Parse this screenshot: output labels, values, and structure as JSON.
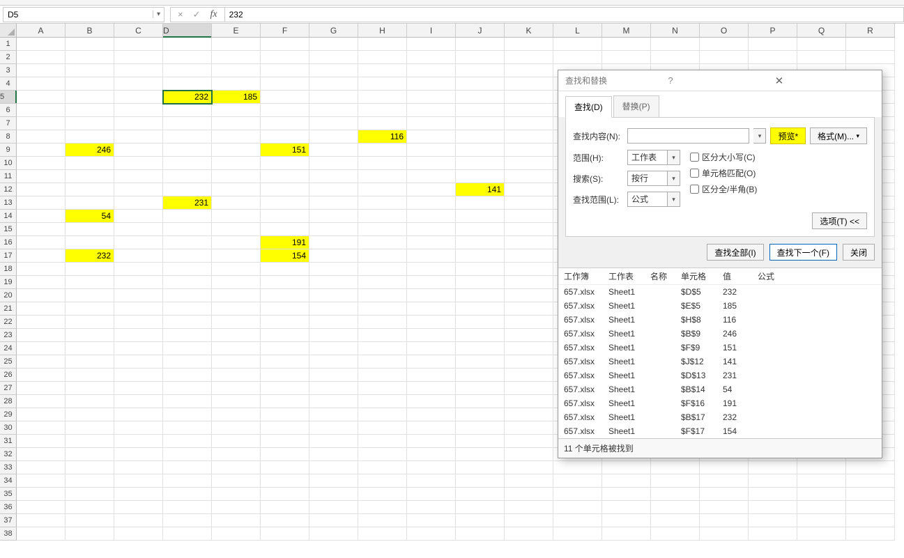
{
  "name_box": {
    "value": "D5"
  },
  "formula_bar": {
    "cancel": "×",
    "confirm": "✓",
    "fx": "fx",
    "value": "232"
  },
  "columns": [
    "A",
    "B",
    "C",
    "D",
    "E",
    "F",
    "G",
    "H",
    "I",
    "J",
    "K",
    "L",
    "M",
    "N",
    "O",
    "P",
    "Q",
    "R"
  ],
  "row_count": 38,
  "selected_col": "D",
  "selected_row": 5,
  "cells": {
    "D5": "232",
    "E5": "185",
    "H8": "116",
    "B9": "246",
    "F9": "151",
    "J12": "141",
    "D13": "231",
    "B14": "54",
    "F16": "191",
    "B17": "232",
    "F17": "154"
  },
  "highlighted": [
    "D5",
    "E5",
    "H8",
    "B9",
    "F9",
    "J12",
    "D13",
    "B14",
    "F16",
    "B17",
    "F17"
  ],
  "dialog": {
    "title": "查找和替换",
    "tabs": {
      "find": "查找(D)",
      "replace": "替换(P)"
    },
    "find_label": "查找内容(N):",
    "find_value": "",
    "preview_btn": "预览*",
    "format_btn": "格式(M)...",
    "range_label": "范围(H):",
    "range_value": "工作表",
    "search_label": "搜索(S):",
    "search_value": "按行",
    "lookin_label": "查找范围(L):",
    "lookin_value": "公式",
    "chk_case": "区分大小写(C)",
    "chk_whole": "单元格匹配(O)",
    "chk_width": "区分全/半角(B)",
    "options_btn": "选项(T) <<",
    "find_all_btn": "查找全部(I)",
    "find_next_btn": "查找下一个(F)",
    "close_btn": "关闭",
    "result_headers": {
      "workbook": "工作簿",
      "worksheet": "工作表",
      "name": "名称",
      "cell": "单元格",
      "value": "值",
      "formula": "公式"
    },
    "results": [
      {
        "wb": "657.xlsx",
        "ws": "Sheet1",
        "nm": "",
        "cell": "$D$5",
        "val": "232",
        "fm": ""
      },
      {
        "wb": "657.xlsx",
        "ws": "Sheet1",
        "nm": "",
        "cell": "$E$5",
        "val": "185",
        "fm": ""
      },
      {
        "wb": "657.xlsx",
        "ws": "Sheet1",
        "nm": "",
        "cell": "$H$8",
        "val": "116",
        "fm": ""
      },
      {
        "wb": "657.xlsx",
        "ws": "Sheet1",
        "nm": "",
        "cell": "$B$9",
        "val": "246",
        "fm": ""
      },
      {
        "wb": "657.xlsx",
        "ws": "Sheet1",
        "nm": "",
        "cell": "$F$9",
        "val": "151",
        "fm": ""
      },
      {
        "wb": "657.xlsx",
        "ws": "Sheet1",
        "nm": "",
        "cell": "$J$12",
        "val": "141",
        "fm": ""
      },
      {
        "wb": "657.xlsx",
        "ws": "Sheet1",
        "nm": "",
        "cell": "$D$13",
        "val": "231",
        "fm": ""
      },
      {
        "wb": "657.xlsx",
        "ws": "Sheet1",
        "nm": "",
        "cell": "$B$14",
        "val": "54",
        "fm": ""
      },
      {
        "wb": "657.xlsx",
        "ws": "Sheet1",
        "nm": "",
        "cell": "$F$16",
        "val": "191",
        "fm": ""
      },
      {
        "wb": "657.xlsx",
        "ws": "Sheet1",
        "nm": "",
        "cell": "$B$17",
        "val": "232",
        "fm": ""
      },
      {
        "wb": "657.xlsx",
        "ws": "Sheet1",
        "nm": "",
        "cell": "$F$17",
        "val": "154",
        "fm": ""
      }
    ],
    "status": "11 个单元格被找到"
  }
}
